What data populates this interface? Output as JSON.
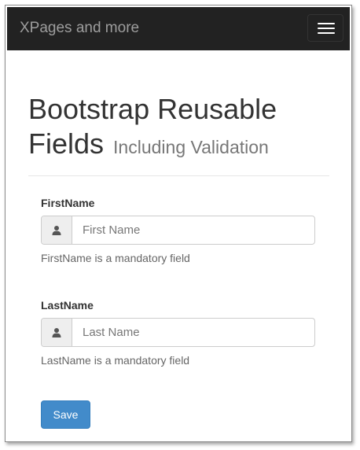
{
  "navbar": {
    "brand": "XPages and more",
    "menu_icon": "hamburger-menu-icon"
  },
  "page": {
    "title": "Bootstrap Reusable Fields",
    "subtitle": "Including Validation"
  },
  "form": {
    "fields": [
      {
        "label": "FirstName",
        "placeholder": "First Name",
        "value": "",
        "icon": "user-icon",
        "help": "FirstName is a mandatory field"
      },
      {
        "label": "LastName",
        "placeholder": "Last Name",
        "value": "",
        "icon": "user-icon",
        "help": "LastName is a mandatory field"
      }
    ],
    "save_label": "Save"
  },
  "colors": {
    "navbar_bg": "#222222",
    "brand_text": "#9d9d9d",
    "primary_button": "#428bca",
    "addon_bg": "#eeeeee"
  }
}
